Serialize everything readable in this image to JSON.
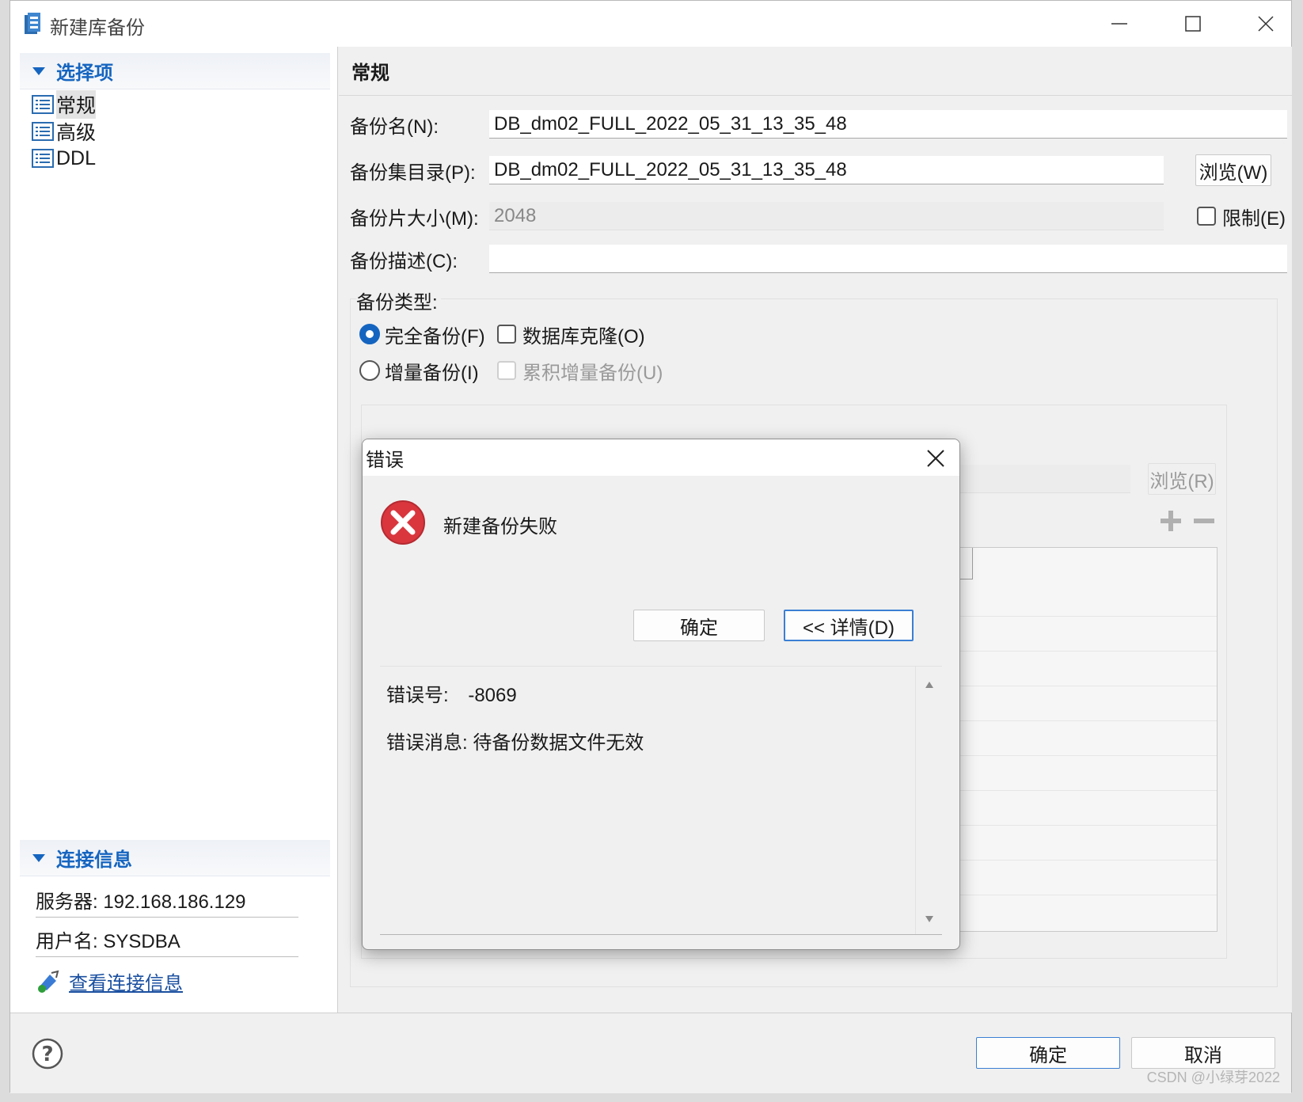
{
  "window": {
    "title": "新建库备份",
    "controls": {
      "minimize": "minimize-icon",
      "maximize": "maximize-icon",
      "close": "close-icon"
    }
  },
  "sidebar": {
    "section_title": "选择项",
    "items": [
      {
        "label": "常规",
        "selected": true
      },
      {
        "label": "高级",
        "selected": false
      },
      {
        "label": "DDL",
        "selected": false
      }
    ],
    "connection": {
      "section_title": "连接信息",
      "server": "服务器: 192.168.186.129",
      "user": "用户名: SYSDBA",
      "link": "查看连接信息"
    }
  },
  "main": {
    "tab_title": "常规",
    "fields": {
      "name_label": "备份名(N):",
      "name_value": "DB_dm02_FULL_2022_05_31_13_35_48",
      "dir_label": "备份集目录(P):",
      "dir_value": "DB_dm02_FULL_2022_05_31_13_35_48",
      "browse_label": "浏览(W)",
      "size_label": "备份片大小(M):",
      "size_value": "2048",
      "limit_label": "限制(E)",
      "desc_label": "备份描述(C):",
      "desc_value": ""
    },
    "backup_type": {
      "label": "备份类型:",
      "full": "完全备份(F)",
      "clone": "数据库克隆(O)",
      "incremental": "增量备份(I)",
      "cumulative": "累积增量备份(U)"
    },
    "browse_r_label": "浏览(R)",
    "add_icon": "plus-icon",
    "remove_icon": "minus-icon"
  },
  "bottom": {
    "help_icon": "help-icon",
    "ok": "确定",
    "cancel": "取消"
  },
  "error_dialog": {
    "title": "错误",
    "message": "新建备份失败",
    "ok": "确定",
    "details": "<< 详情(D)",
    "error_no_label": "错误号:",
    "error_no_value": "-8069",
    "error_msg": "错误消息: 待备份数据文件无效"
  },
  "watermark": "CSDN @小绿芽2022",
  "colors": {
    "accent": "#1565c0",
    "error_red": "#d9363e",
    "link": "#1a4fa0"
  }
}
